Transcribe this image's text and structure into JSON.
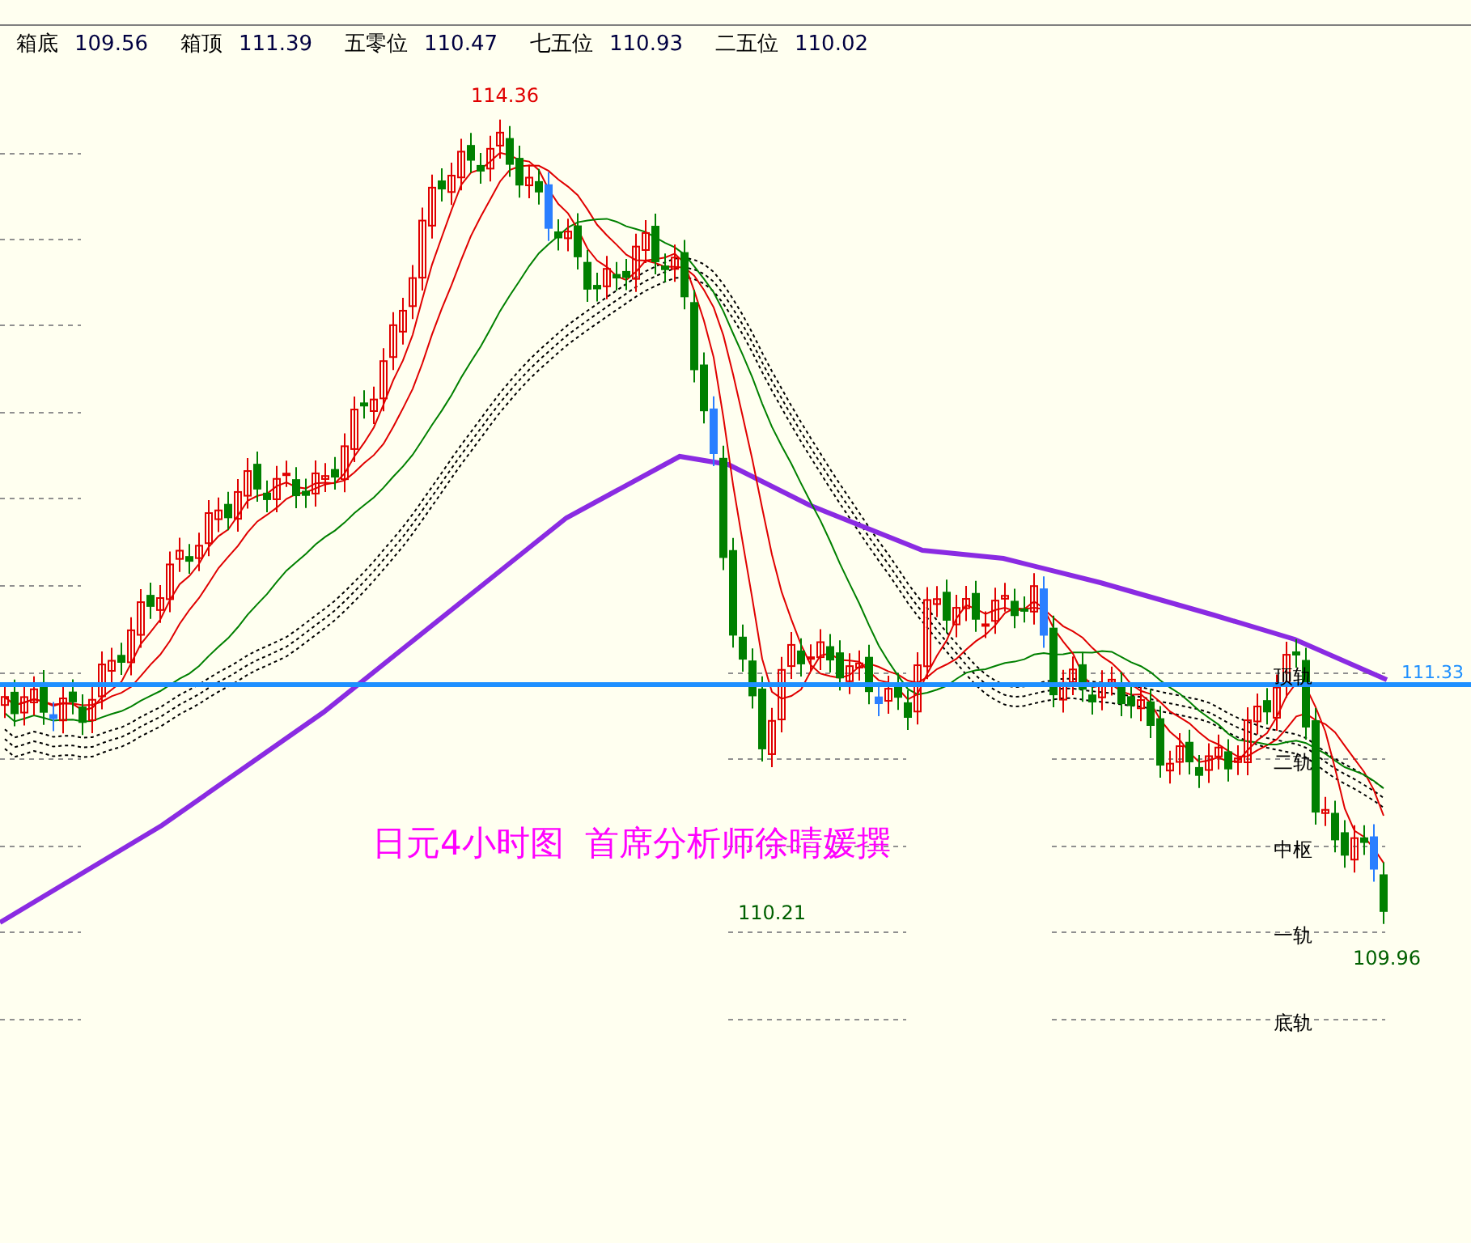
{
  "stats": [
    {
      "label": "箱底",
      "value": "109.56"
    },
    {
      "label": "箱顶",
      "value": "111.39"
    },
    {
      "label": "五零位",
      "value": "110.47"
    },
    {
      "label": "七五位",
      "value": "110.93"
    },
    {
      "label": "二五位",
      "value": "110.02"
    }
  ],
  "chart": {
    "title": "日元4小时图  首席分析师徐晴媛撰",
    "high_label": "114.36",
    "low_label": "110.21",
    "last_label": "109.96",
    "price_line_label": "111.33",
    "levels": [
      "顶轨",
      "二轨",
      "中枢",
      "一轨",
      "底轨"
    ]
  }
}
